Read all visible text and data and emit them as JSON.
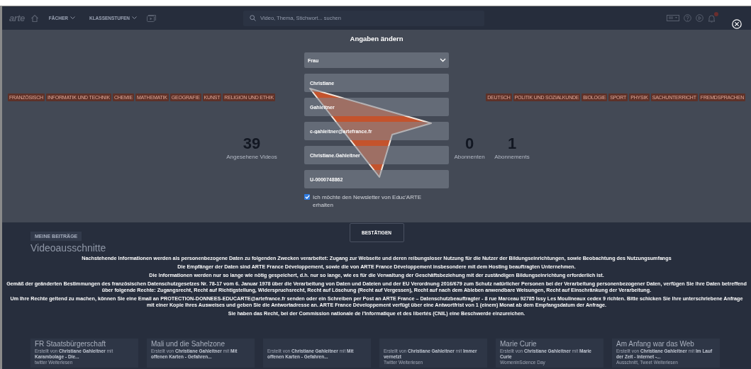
{
  "nav": {
    "logo": "arte",
    "menus": [
      {
        "label": "FÄCHER"
      },
      {
        "label": "KLASSENSTUFEN"
      }
    ],
    "search": {
      "placeholder": "Video, Thema, Stichwort... suchen"
    }
  },
  "profile": {
    "tags_left": [
      "FRANZÖSISCH",
      "INFORMATIK UND TECHNIK",
      "CHEMIE",
      "MATHEMATIK",
      "GEOGRAFIE",
      "KUNST",
      "RELIGION UND ETHIK"
    ],
    "tags_right": [
      "DEUTSCH",
      "POLITIK UND SOZIALKUNDE",
      "BIOLOGIE",
      "SPORT",
      "PHYSIK",
      "SACHUNTERRICHT",
      "FREMDSPRACHEN"
    ],
    "stats_left": [
      {
        "value": "39",
        "label": "Angesehene Videos"
      }
    ],
    "stats_right": [
      {
        "value": "0",
        "label": "Abonnenten"
      },
      {
        "value": "1",
        "label": "Abonnements"
      }
    ]
  },
  "contributions": {
    "tab": "MEINE BEITRÄGE",
    "heading": "Videoausschnitte",
    "cards": [
      {
        "title": "FR Staatsbürgerschaft",
        "byline": "Erstellt von **Christiane Gahleitner** mit **Karambolage - Die...**",
        "footer": "twitter Weiterlesen"
      },
      {
        "title": "Mali und die Sahelzone",
        "byline": "Erstellt von **Christiane Gahleitner** mit **Mit offenen Karten - Gefahren...**"
      },
      {
        "byline": "Erstellt von **Christiane Gahleitner** mit **Mit offenen Karten - Gefahren...**"
      },
      {
        "byline": "Erstellt von **Christiane Gahleitner** mit **Immer vernetzt**",
        "footer": "Twitter Weiterlesen"
      },
      {
        "title": "Marie Curie",
        "byline": "Erstellt von **Christiane Gahleitner** mit **Marie Curie**",
        "footer": "WomeninScience Day"
      },
      {
        "title": "Am Anfang war das Web",
        "byline": "Erstellt von **Christiane Gahleitner** mit **Im Lauf der Zeit - Internet -...**",
        "footer": "Ausschnitt, Tweet Weiterlesen"
      }
    ]
  },
  "modal": {
    "title": "Angaben ändern",
    "salutation": "Frau",
    "fields": [
      "Christiane",
      "Gahleitner",
      "c-gahleitner@artefrance.fr",
      "Christiane.Gahleitner",
      "U-0000748862"
    ],
    "newsletter": {
      "label": "Ich möchte den Newsletter von Educ'ARTE erhalten",
      "checked": true
    },
    "confirm": "BESTÄTIGEN",
    "privacy": [
      "Nachstehende Informationen werden als personenbezogene Daten zu folgenden Zwecken verarbeitet: Zugang zur Webseite und deren reibungsloser Nutzung für die Nutzer der Bildungseinrichtungen, sowie Beobachtung des Nutzungsumfangs",
      "Die Empfänger der Daten sind ARTE France Développement, sowie die von ARTE France Développement insbesondere mit dem Hosting beauftragten Unternehmen.",
      "Die Informationen werden nur so lange wie nötig gespeichert, d.h. nur so lange, wie es für die Verwaltung der Geschäftsbeziehung mit der zuständigen Bildungseinrichtung erforderlich ist.",
      "Gemäß der geänderten Bestimmungen des französischen Datenschutzgesetzes Nr. 78-17 vom 6. Januar 1978 über die Verarbeitung von Daten und Dateien und der EU Verordnung 2016/679 zum Schutz natürlicher Personen bei der Verarbeitung personenbezogener Daten, verfügen Sie Ihre Daten betreffend über folgende Rechte: Zugangsrecht, Recht auf Richtigstellung, Widerspruchsrecht, Recht auf Löschung (Recht auf Vergessen), Recht auf nach dem Ableben anwendbare Weisungen, Recht auf Einschränkung der Verarbeitung.",
      "Um Ihre Rechte geltend zu machen, können Sie eine Email an PROTECTION-DONNEES-EDUCARTE@artefrance.fr senden oder ein Schreiben per Post an ARTE France – Datenschutzbeauftragter - 8 rue Marceau 92785 Issy Les Moulineaux cedex 9 richten. Bitte schicken Sie Ihre unterschriebene Anfrage mit einer Kopie Ihres Ausweises und geben Sie die Antwortadresse an. ARTE France Développement verfügt über eine Antwortfrist von 1 (einem) Monat ab dem Empfangsdatum der Anfrage.",
      "Sie haben das Recht, bei der Commission nationale de l'Informatique et des libertés (CNIL) eine Beschwerde einzureichen."
    ]
  }
}
